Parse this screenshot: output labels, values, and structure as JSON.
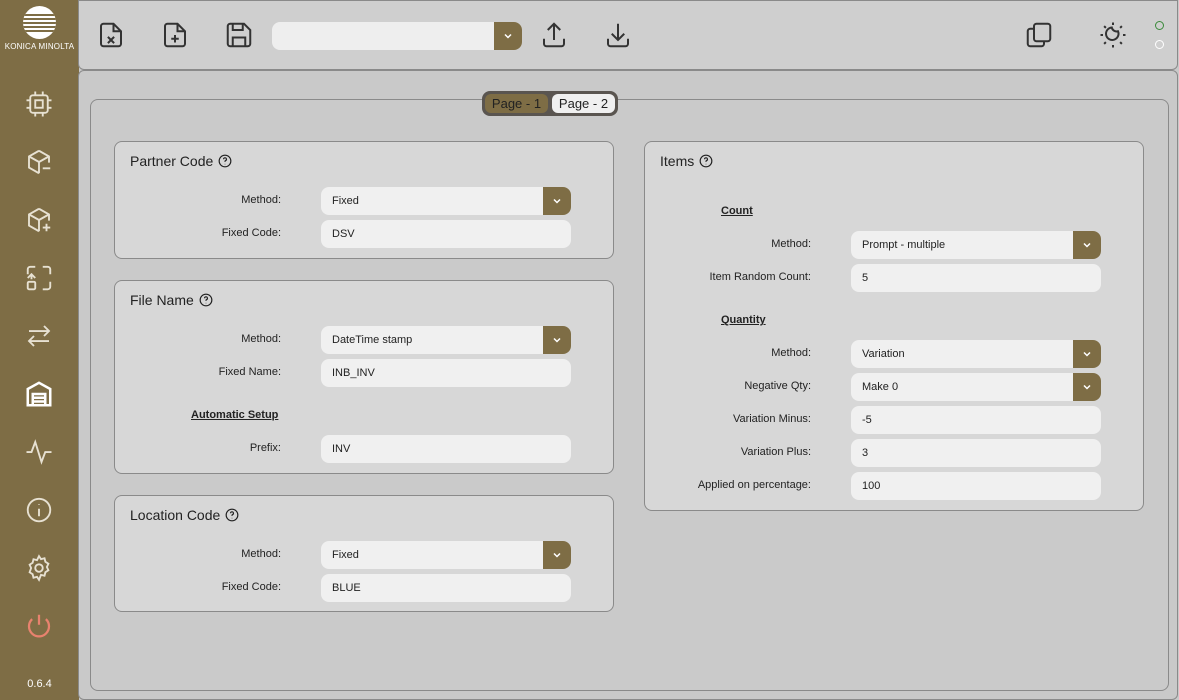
{
  "brand": {
    "name": "KONICA MINOLTA"
  },
  "version": "0.6.4",
  "colors": {
    "accent": "#7e6d45",
    "power": "#e8826e",
    "status_online": "#3a8a3a"
  },
  "sidebar": {
    "items": [
      {
        "icon": "cpu-chip-icon"
      },
      {
        "icon": "package-minus-icon"
      },
      {
        "icon": "package-plus-icon"
      },
      {
        "icon": "move-transfer-icon"
      },
      {
        "icon": "arrows-exchange-icon"
      },
      {
        "icon": "warehouse-icon",
        "active": true
      },
      {
        "icon": "activity-pulse-icon"
      },
      {
        "icon": "info-icon"
      },
      {
        "icon": "settings-gear-icon"
      },
      {
        "icon": "power-icon"
      }
    ]
  },
  "toolbar": {
    "close_file_icon": "file-close-icon",
    "new_file_icon": "file-add-icon",
    "save_icon": "save-icon",
    "dropdown_value": "",
    "upload_icon": "upload-icon",
    "download_icon": "download-icon",
    "copy_icon": "copy-icon",
    "theme_icon": "theme-toggle-icon"
  },
  "tabs": [
    {
      "label": "Page - 1",
      "active": false
    },
    {
      "label": "Page - 2",
      "active": true
    }
  ],
  "partner_code": {
    "title": "Partner Code",
    "method_label": "Method:",
    "method_value": "Fixed",
    "fixed_code_label": "Fixed Code:",
    "fixed_code_value": "DSV"
  },
  "file_name": {
    "title": "File Name",
    "method_label": "Method:",
    "method_value": "DateTime stamp",
    "fixed_name_label": "Fixed Name:",
    "fixed_name_value": "INB_INV",
    "auto_section": "Automatic Setup",
    "prefix_label": "Prefix:",
    "prefix_value": "INV"
  },
  "location_code": {
    "title": "Location Code",
    "method_label": "Method:",
    "method_value": "Fixed",
    "fixed_code_label": "Fixed Code:",
    "fixed_code_value": "BLUE"
  },
  "items": {
    "title": "Items",
    "count_section": "Count",
    "count_method_label": "Method:",
    "count_method_value": "Prompt - multiple",
    "random_count_label": "Item Random Count:",
    "random_count_value": "5",
    "quantity_section": "Quantity",
    "qty_method_label": "Method:",
    "qty_method_value": "Variation",
    "negative_label": "Negative Qty:",
    "negative_value": "Make 0",
    "var_minus_label": "Variation Minus:",
    "var_minus_value": "-5",
    "var_plus_label": "Variation Plus:",
    "var_plus_value": "3",
    "applied_label": "Applied on percentage:",
    "applied_value": "100"
  }
}
